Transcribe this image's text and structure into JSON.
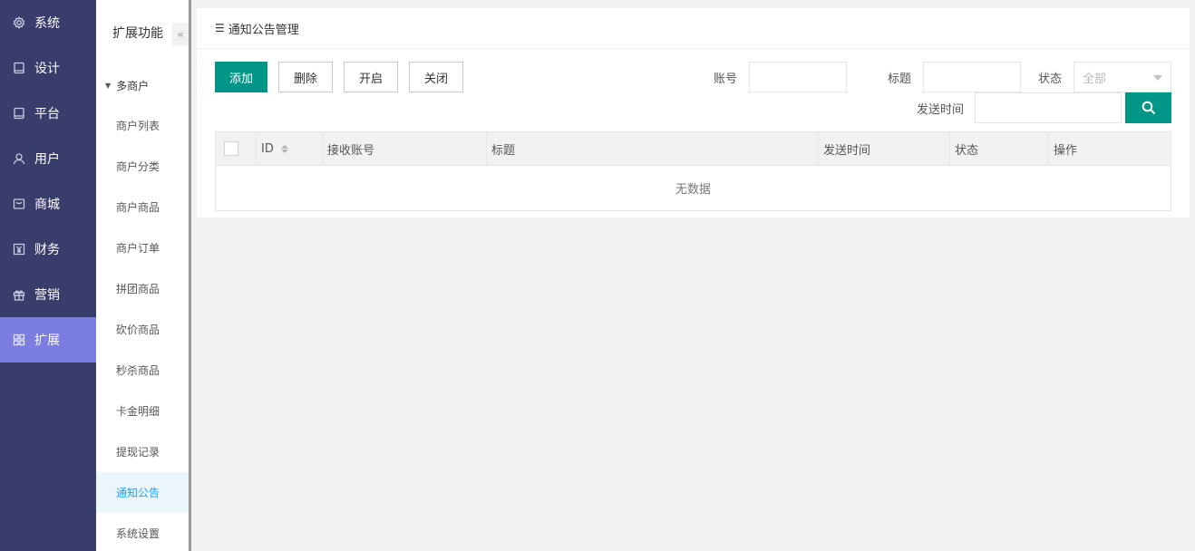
{
  "nav": {
    "items": [
      {
        "label": "系统",
        "icon": "gear-icon"
      },
      {
        "label": "设计",
        "icon": "tablet-icon"
      },
      {
        "label": "平台",
        "icon": "tablet-icon"
      },
      {
        "label": "用户",
        "icon": "user-icon"
      },
      {
        "label": "商城",
        "icon": "mall-icon"
      },
      {
        "label": "财务",
        "icon": "yuan-icon"
      },
      {
        "label": "营销",
        "icon": "gift-icon"
      },
      {
        "label": "扩展",
        "icon": "grid-icon",
        "active": true
      }
    ]
  },
  "subnav": {
    "title": "扩展功能",
    "collapse": "«",
    "group": "多商户",
    "items": [
      "商户列表",
      "商户分类",
      "商户商品",
      "商户订单",
      "拼团商品",
      "砍价商品",
      "秒杀商品",
      "卡金明细",
      "提现记录",
      "通知公告",
      "系统设置"
    ],
    "active_index": 9
  },
  "card": {
    "title": "通知公告管理",
    "toolbar": {
      "add": "添加",
      "delete": "删除",
      "enable": "开启",
      "disable": "关闭"
    },
    "filters": {
      "account_label": "账号",
      "account_value": "",
      "title_label": "标题",
      "title_value": "",
      "status_label": "状态",
      "status_value": "全部",
      "send_time_label": "发送时间",
      "send_time_value": ""
    },
    "table": {
      "columns": [
        "ID",
        "接收账号",
        "标题",
        "发送时间",
        "状态",
        "操作"
      ],
      "rows": [],
      "empty_text": "无数据"
    }
  },
  "colors": {
    "nav_bg": "#393d6c",
    "nav_active": "#7b7de0",
    "primary": "#009688",
    "sub_active": "#1e9fff"
  }
}
